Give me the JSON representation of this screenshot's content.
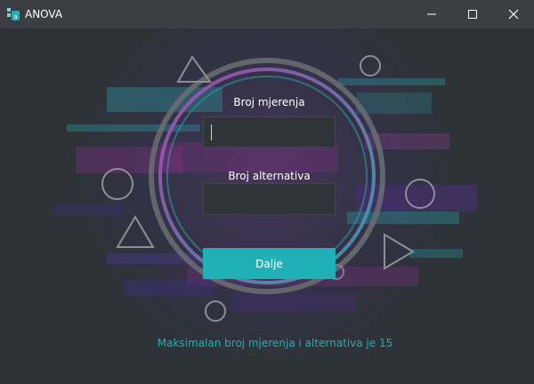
{
  "window": {
    "title": "ANOVA"
  },
  "form": {
    "measurements_label": "Broj mjerenja",
    "measurements_value": "",
    "alternatives_label": "Broj alternativa",
    "alternatives_value": "",
    "submit_label": "Dalje"
  },
  "footer": {
    "note": "Maksimalan broj mjerenja i alternativa je 15"
  },
  "colors": {
    "accent": "#1fb1b6",
    "background": "#2e3338",
    "titlebar": "#3b3f43"
  },
  "icons": [
    "app-icon",
    "minimize-icon",
    "maximize-icon",
    "close-icon"
  ]
}
